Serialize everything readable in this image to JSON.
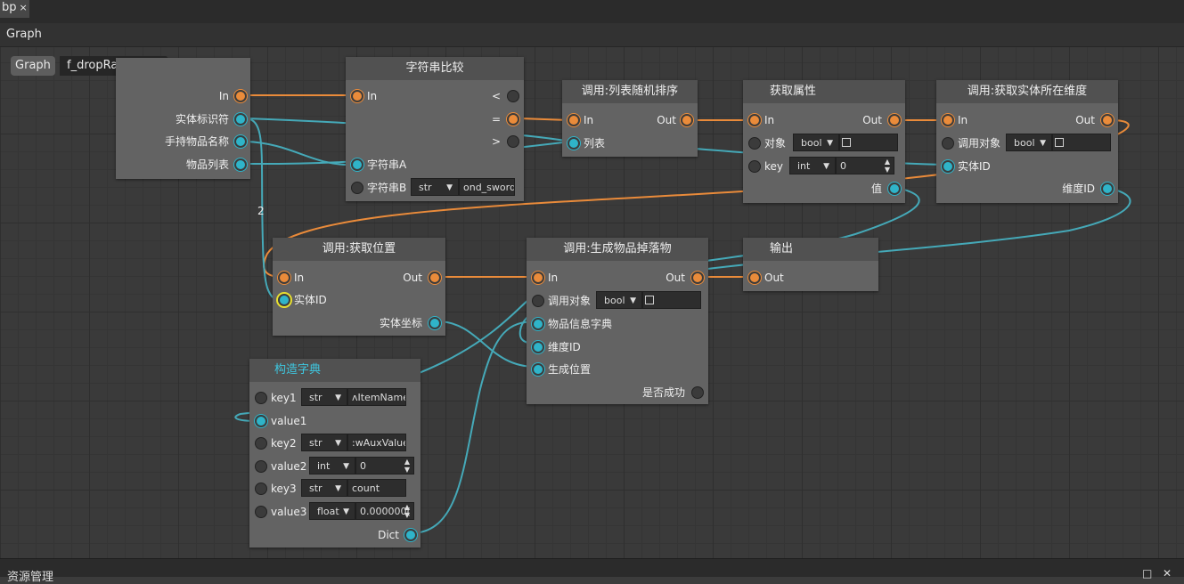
{
  "tab": {
    "label": "bp",
    "close": "×"
  },
  "graph_label": "Graph",
  "breadcrumb": {
    "root": "Graph",
    "function": "f_dropRandomItem"
  },
  "nodes": {
    "entry": {
      "in": "In",
      "entity_id": "实体标识符",
      "held_item": "手持物品名称",
      "item_list": "物品列表"
    },
    "strcmp": {
      "title": "字符串比较",
      "in": "In",
      "lt": "<",
      "eq": "=",
      "gt": ">",
      "str_a": "字符串A",
      "str_b": "字符串B",
      "type_b": "str",
      "value_b": "ond_sword"
    },
    "shuffle": {
      "title": "调用:列表随机排序",
      "in": "In",
      "out": "Out",
      "list": "列表"
    },
    "getattr": {
      "title": "获取属性",
      "in": "In",
      "out": "Out",
      "obj": "对象",
      "obj_type": "bool",
      "key": "key",
      "key_type": "int",
      "key_value": "0",
      "value": "值"
    },
    "getdim": {
      "title": "调用:获取实体所在维度",
      "in": "In",
      "out": "Out",
      "target": "调用对象",
      "target_type": "bool",
      "entity_id": "实体ID",
      "dim_id": "维度ID"
    },
    "getpos": {
      "title": "调用:获取位置",
      "in": "In",
      "out": "Out",
      "entity_id": "实体ID",
      "pos": "实体坐标"
    },
    "spawn": {
      "title": "调用:生成物品掉落物",
      "in": "In",
      "out": "Out",
      "target": "调用对象",
      "target_type": "bool",
      "item_dict": "物品信息字典",
      "dim_id": "维度ID",
      "pos": "生成位置",
      "success": "是否成功"
    },
    "output": {
      "title": "输出",
      "out": "Out"
    },
    "makedict": {
      "title": "构造字典",
      "rows": [
        {
          "label": "key1",
          "type": "str",
          "value": "ʌItemName"
        },
        {
          "label": "value1",
          "type": "",
          "value": ""
        },
        {
          "label": "key2",
          "type": "str",
          "value": ":wAuxValue"
        },
        {
          "label": "value2",
          "type": "int",
          "value": "0"
        },
        {
          "label": "key3",
          "type": "str",
          "value": "count"
        },
        {
          "label": "value3",
          "type": "float",
          "value": "0.000000("
        }
      ],
      "dict": "Dict"
    }
  },
  "wire_badge": "2",
  "footer": {
    "title": "资源管理",
    "btn1": "□",
    "btn2": "✕"
  },
  "colors": {
    "exec_pin": "#ea8b3a",
    "data_pin": "#2fb4c9",
    "selected_pin_ring": "#e8e030",
    "title_accent": "#3ec7e0"
  }
}
